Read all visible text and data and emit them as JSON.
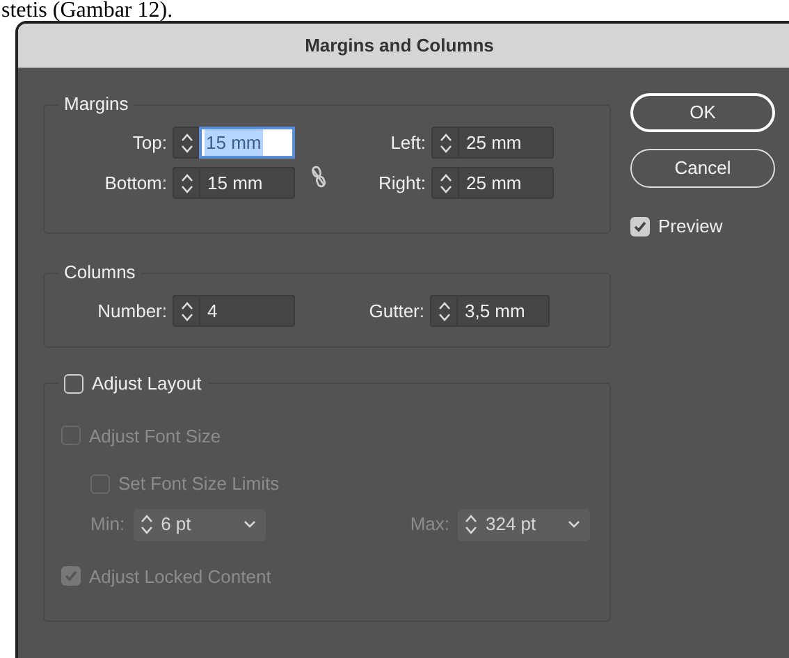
{
  "page_text": "stetis (Gambar 12).",
  "dialog": {
    "title": "Margins and Columns",
    "margins": {
      "legend": "Margins",
      "rows": [
        [
          {
            "label": "Top:",
            "value": "15 mm",
            "focused": true
          },
          {
            "label": "Left:",
            "value": "25 mm",
            "focused": false
          }
        ],
        [
          {
            "label": "Bottom:",
            "value": "15 mm",
            "focused": false
          },
          {
            "label": "Right:",
            "value": "25 mm",
            "focused": false
          }
        ]
      ]
    },
    "columns": {
      "legend": "Columns",
      "fields": [
        {
          "label": "Number:",
          "value": "4"
        },
        {
          "label": "Gutter:",
          "value": "3,5 mm"
        }
      ]
    },
    "adjust_layout": {
      "label": "Adjust Layout",
      "checked": false,
      "font_size": {
        "label": "Adjust Font Size",
        "checked": false,
        "disabled": true,
        "children": [
          {
            "label": "Set Font Size Limits",
            "checked": false,
            "disabled": true
          }
        ]
      },
      "limits": [
        {
          "label": "Min:",
          "value": "6 pt",
          "disabled": true
        },
        {
          "label": "Max:",
          "value": "324 pt",
          "disabled": true
        }
      ],
      "locked_content": {
        "label": "Adjust Locked Content",
        "checked": true,
        "disabled": true
      }
    },
    "buttons": [
      {
        "label": "OK",
        "kind": "default"
      },
      {
        "label": "Cancel",
        "kind": "normal"
      }
    ],
    "preview": {
      "label": "Preview",
      "checked": true
    }
  }
}
